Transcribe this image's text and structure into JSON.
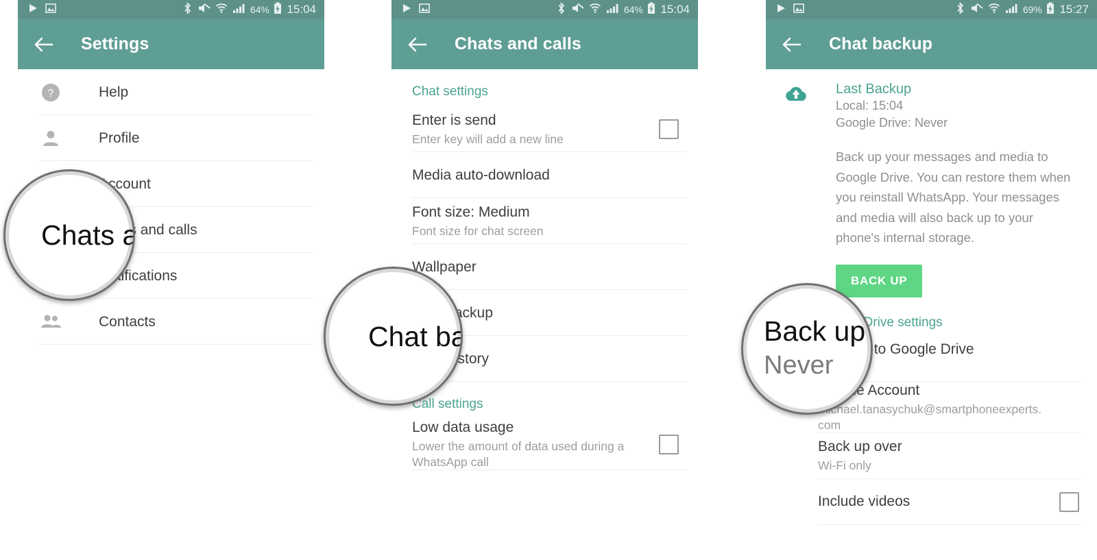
{
  "statusbar": {
    "play_icon": "play-icon",
    "image_icon": "image-icon",
    "bluetooth_icon": "bluetooth-icon",
    "mute_icon": "volume-mute-icon",
    "wifi_icon": "wifi-icon",
    "signal_icon": "cellular-signal-icon",
    "battery_icon": "battery-charging-icon",
    "panel1": {
      "battery_pct": "64%",
      "clock": "15:04"
    },
    "panel2": {
      "battery_pct": "64%",
      "clock": "15:04"
    },
    "panel3": {
      "battery_pct": "69%",
      "clock": "15:27"
    }
  },
  "colors": {
    "appbar_teal": "#5f9e95",
    "statusbar_teal": "#5d918a",
    "section_header_teal": "#4aa391",
    "accent_green_button": "#5fd684",
    "title_text": "#3e3e3e",
    "subtitle_text": "#9d9d9d"
  },
  "panel1": {
    "back_icon": "back-arrow-icon",
    "title": "Settings",
    "rows": [
      {
        "icon": "help-circle-icon",
        "title": "Help"
      },
      {
        "icon": "person-icon",
        "title": "Profile"
      },
      {
        "icon": "key-icon",
        "title": "Account"
      },
      {
        "icon": "chat-icon",
        "title": "Chats and calls"
      },
      {
        "icon": "notification-icon",
        "title": "Notifications"
      },
      {
        "icon": "contacts-icon",
        "title": "Contacts"
      }
    ],
    "loupe": {
      "title": "Chats a"
    }
  },
  "panel2": {
    "back_icon": "back-arrow-icon",
    "title": "Chats and calls",
    "sections": [
      {
        "header": "Chat settings",
        "rows": [
          {
            "title": "Enter is send",
            "sub": "Enter key will add a new line",
            "checkbox": true,
            "checked": false
          },
          {
            "title": "Media auto-download",
            "sub": ""
          },
          {
            "title": "Font size: Medium",
            "sub": "Font size for chat screen"
          },
          {
            "title": "Wallpaper",
            "sub": ""
          },
          {
            "title": "Chat backup",
            "sub": ""
          },
          {
            "title": "Chat history",
            "sub": ""
          }
        ]
      },
      {
        "header": "Call settings",
        "rows": [
          {
            "title": "Low data usage",
            "sub": "Lower the amount of data used during a WhatsApp call",
            "checkbox": true,
            "checked": false
          }
        ]
      }
    ],
    "loupe": {
      "title": "Chat ba"
    }
  },
  "panel3": {
    "back_icon": "back-arrow-icon",
    "title": "Chat backup",
    "backup": {
      "cloud_icon": "cloud-upload-icon",
      "heading": "Last Backup",
      "local_line": "Local: 15:04",
      "drive_line": "Google Drive: Never",
      "description": "Back up your messages and media to Google Drive. You can restore them when you reinstall WhatsApp. Your messages and media will also back up to your phone's internal storage.",
      "button_label": "BACK UP"
    },
    "drive_section": {
      "header": "Google Drive settings",
      "rows": [
        {
          "title": "Back up to Google Drive",
          "sub": "Never"
        },
        {
          "title": "Google Account",
          "sub": "michael.tanasychuk@smartphoneexperts.com"
        },
        {
          "title": "Back up over",
          "sub": "Wi-Fi only"
        },
        {
          "title": "Include videos",
          "sub": "",
          "checkbox": true,
          "checked": false
        }
      ]
    },
    "loupe": {
      "title": "Back up",
      "sub": "Never"
    }
  }
}
